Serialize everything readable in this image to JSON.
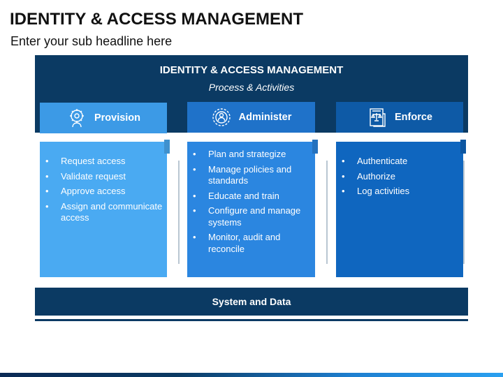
{
  "slide": {
    "title": "IDENTITY & ACCESS MANAGEMENT",
    "subtitle": "Enter your sub headline here"
  },
  "header": {
    "title": "IDENTITY & ACCESS MANAGEMENT",
    "subtitle": "Process & Activities"
  },
  "columns": [
    {
      "label": "Provision",
      "icon": "user-gear-icon",
      "tab_color": "#3c9ae6",
      "box_color": "#4aaaf2",
      "items": [
        "Request access",
        "Validate request",
        "Approve access",
        "Assign and communicate access"
      ]
    },
    {
      "label": "Administer",
      "icon": "settings-person-icon",
      "tab_color": "#1f72c9",
      "box_color": "#2b86e0",
      "items": [
        "Plan and strategize",
        "Manage policies and standards",
        "Educate and train",
        "Configure and manage systems",
        "Monitor, audit and reconcile"
      ]
    },
    {
      "label": "Enforce",
      "icon": "document-scale-icon",
      "tab_color": "#0e5aa6",
      "box_color": "#0f66bf",
      "items": [
        "Authenticate",
        "Authorize",
        "Log activities"
      ]
    }
  ],
  "footer": {
    "label": "System and Data"
  }
}
